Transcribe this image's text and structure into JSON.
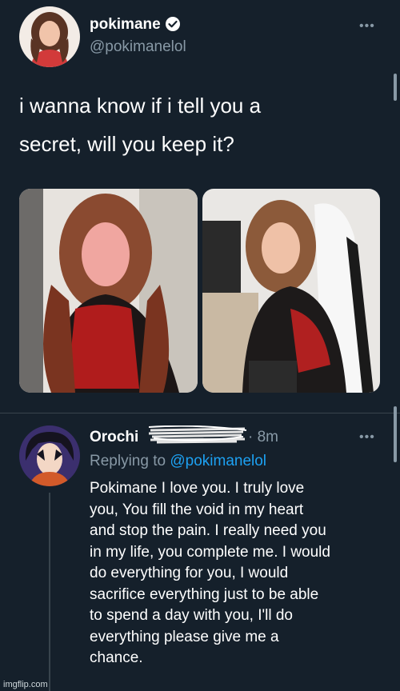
{
  "tweet": {
    "author_name": "pokimane",
    "handle": "@pokimanelol",
    "text_lines": [
      "i wanna know if i tell you a",
      "secret, will you keep it?"
    ],
    "more_label": "•••"
  },
  "reply": {
    "author_name": "Orochi",
    "timestamp": "· 8m",
    "replying_prefix": "Replying to ",
    "replying_handle": "@pokimanelol",
    "text_lines": [
      "Pokimane I love you. I truly love",
      "you, You fill the void in my heart",
      "and stop the pain. I really need you",
      "in my life, you complete me. I would",
      "do everything for you, I would",
      "sacrifice everything just to be able",
      "to spend a day with you, I'll do",
      "everything please give me a",
      "chance."
    ],
    "more_label": "•••"
  },
  "watermark": "imgflip.com",
  "colors": {
    "background": "#15202b",
    "text_secondary": "#8899a6",
    "link": "#1da1f2",
    "verified": "#ffffff",
    "divider": "#38444d"
  },
  "icons": [
    "verified-badge-icon",
    "more-options-icon"
  ]
}
